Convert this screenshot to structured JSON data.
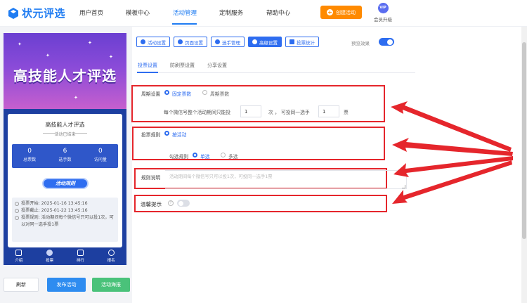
{
  "brand": {
    "name": "状元评选",
    "color": "#1f7cf2"
  },
  "nav": {
    "items": [
      "用户首页",
      "模板中心",
      "活动管理",
      "定制服务",
      "帮助中心"
    ],
    "active_index": 2,
    "create_label": "创建活动",
    "vip_badge": "VIP",
    "vip_label": "会员升级"
  },
  "preview": {
    "banner_title": "高技能人才评选",
    "card_title": "高技能人才评选",
    "status": "活动已结束",
    "stats": [
      {
        "value": "0",
        "label": "总票数"
      },
      {
        "value": "6",
        "label": "选手数"
      },
      {
        "value": "0",
        "label": "访问量"
      }
    ],
    "rule_button": "活动规则",
    "info": [
      "投票开始:  2025-01-16 13:45:16",
      "投票截止:  2025-01-22 13:45:16",
      "投票规则:  活动期间每个微信号只可以投1次，可以对同一选手投1票"
    ],
    "tabs": [
      "介绍",
      "投票",
      "排行",
      "报名"
    ]
  },
  "actions": {
    "refresh": "刷新",
    "publish": "发布活动",
    "poster": "活动海报"
  },
  "settings": {
    "toolbar": [
      "活动设置",
      "页面设置",
      "选手管理",
      "高级设置",
      "投票统计"
    ],
    "toolbar_active_index": 3,
    "preview_effect_label": "预览效果",
    "preview_effect_on": true,
    "subtabs": [
      "投票设置",
      "防刷票设置",
      "分享设置"
    ],
    "subtab_active_index": 0,
    "cycle": {
      "label": "周期设置",
      "options": [
        "固定票数",
        "周期票数"
      ],
      "selected": 0,
      "text_before": "每个微信号整个活动期间只能投",
      "count_value": "1",
      "text_mid": "次 ， 可投同一选手",
      "same_value": "1",
      "text_after": "票"
    },
    "rule": {
      "label": "投票规则",
      "mode_option": "按活动",
      "check_label": "勾选规则",
      "options": [
        "单选",
        "多选"
      ],
      "selected": 0
    },
    "description": {
      "label": "规则说明",
      "placeholder": "活动期间每个微信号只可以投1次，可投同一选手1票"
    },
    "tip": {
      "label": "温馨提示",
      "help_icon": "?",
      "enabled": false
    }
  },
  "colors": {
    "accent": "#2e6df0",
    "highlight": "#e5262c",
    "orange": "#ff8a00",
    "green": "#4ac27a"
  }
}
